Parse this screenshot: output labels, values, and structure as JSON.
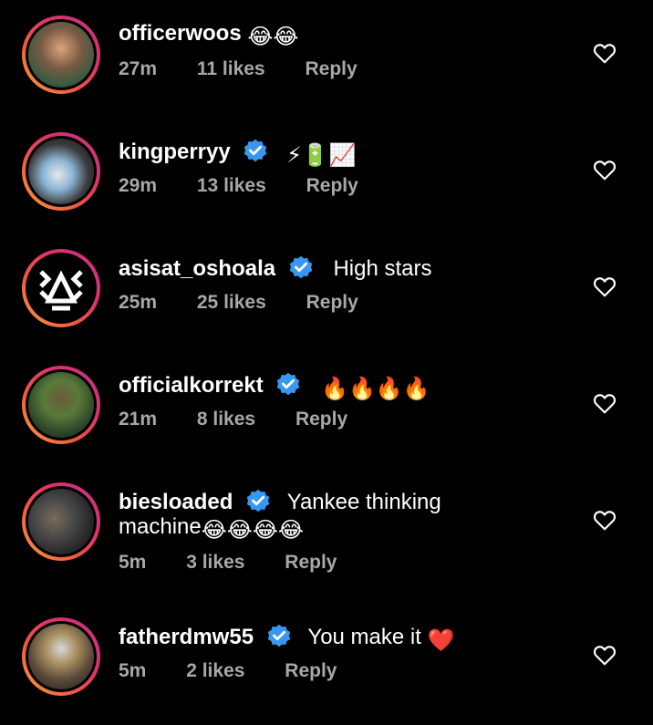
{
  "comments": [
    {
      "username": "officerwoos",
      "text": "",
      "emojis": [
        "😂",
        "😂"
      ],
      "verified": false,
      "time": "27m",
      "likes": "11 likes",
      "reply": "Reply"
    },
    {
      "username": "kingperryy",
      "text": "",
      "emojis": [
        "⚡",
        "🔋",
        "📈"
      ],
      "verified": true,
      "time": "29m",
      "likes": "13 likes",
      "reply": "Reply"
    },
    {
      "username": "asisat_oshoala",
      "text": "High stars",
      "emojis": [],
      "verified": true,
      "time": "25m",
      "likes": "25 likes",
      "reply": "Reply"
    },
    {
      "username": "officialkorrekt",
      "text": "",
      "emojis": [
        "🔥",
        "🔥",
        "🔥",
        "🔥"
      ],
      "verified": true,
      "time": "21m",
      "likes": "8 likes",
      "reply": "Reply"
    },
    {
      "username": "biesloaded",
      "text": "Yankee thinking",
      "text2": "machine",
      "emojis": [
        "😂",
        "😂",
        "😂",
        "😂"
      ],
      "verified": true,
      "time": "5m",
      "likes": "3 likes",
      "reply": "Reply"
    },
    {
      "username": "fatherdmw55",
      "text": "You make it",
      "emojis": [
        "❤️"
      ],
      "verified": true,
      "time": "5m",
      "likes": "2 likes",
      "reply": "Reply"
    }
  ],
  "colors": {
    "background": "#000000",
    "text": "#ffffff",
    "meta": "#a8a8a8",
    "verified": "#3897f0"
  }
}
